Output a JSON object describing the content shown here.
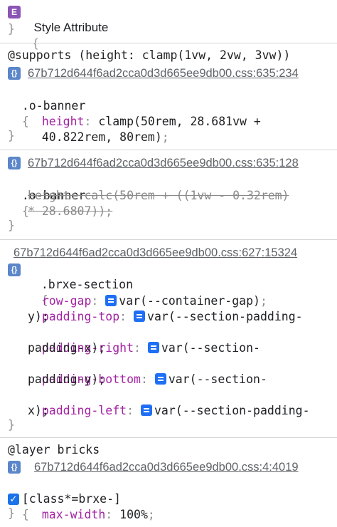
{
  "block1": {
    "badge": "E",
    "title": "Style Attribute",
    "open": "{",
    "close": "}"
  },
  "block2": {
    "supports": "@supports (height: clamp(1vw, 2vw, 3vw))",
    "badge": "{}",
    "source": "67b712d644f6ad2cca0d3d665ee9db00.css:635:234",
    "selector": ".o-banner",
    "open": "{",
    "prop": "height",
    "value_line1": "clamp(50rem, 28.681vw +",
    "value_line2": "40.822rem, 80rem)",
    "semicolon": ";",
    "close": "}"
  },
  "block3": {
    "badge": "{}",
    "source": "67b712d644f6ad2cca0d3d665ee9db00.css:635:128",
    "selector": ".o-banner",
    "open": "{",
    "struck_line1": "height: calc(50rem + ((1vw - 0.32rem)",
    "struck_line2": "* 28.6807));",
    "close": "}"
  },
  "block4": {
    "source": "67b712d644f6ad2cca0d3d665ee9db00.css:627:15324",
    "badge": "{}",
    "selector": ".brxe-section",
    "open": "{",
    "props": [
      {
        "name": "row-gap",
        "value": "var(--container-gap)",
        "cont": ""
      },
      {
        "name": "padding-top",
        "value": "var(--section-padding-",
        "cont": "y);"
      },
      {
        "name": "padding-right",
        "value": "var(--section-",
        "cont": "padding-x);"
      },
      {
        "name": "padding-bottom",
        "value": "var(--section-",
        "cont": "padding-y);"
      },
      {
        "name": "padding-left",
        "value": "var(--section-padding-",
        "cont": "x);"
      }
    ],
    "close": "}"
  },
  "block5": {
    "layer": "@layer bricks",
    "badge": "{}",
    "source": "67b712d644f6ad2cca0d3d665ee9db00.css:4:4019",
    "selector": "[class*=brxe-]",
    "open": "{",
    "prop": "max-width",
    "value": "100%",
    "checked": true,
    "close": "}"
  }
}
